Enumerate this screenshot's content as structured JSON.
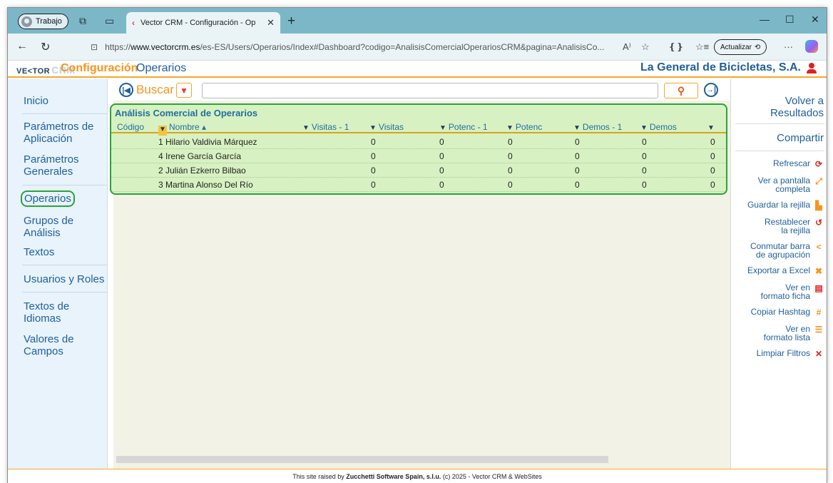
{
  "browser": {
    "profile": "Trabajo",
    "tab_title": "Vector CRM - Configuración - Op",
    "url_prefix": "https://",
    "url_host": "www.vectorcrm.es",
    "url_path": "/es-ES/Users/Operarios/Index#Dashboard?codigo=AnalisisComercialOperariosCRM&pagina=AnalisisCo...",
    "update_label": "Actualizar"
  },
  "header": {
    "logo_text": "VE<TOR",
    "logo_bg": "CRM",
    "title": "Configuración",
    "subtitle": "Operarios",
    "company": "La General de Bicicletas, S.A."
  },
  "sidebar": {
    "items": [
      {
        "label": "Inicio"
      },
      {
        "label": "Parámetros de Aplicación"
      },
      {
        "label": "Parámetros Generales"
      },
      {
        "label": "Operarios"
      },
      {
        "label": "Grupos de Análisis"
      },
      {
        "label": "Textos"
      },
      {
        "label": "Usuarios y Roles"
      },
      {
        "label": "Textos de Idiomas"
      },
      {
        "label": "Valores de Campos"
      }
    ]
  },
  "search": {
    "label": "Buscar",
    "value": ""
  },
  "grid": {
    "title": "Análisis Comercial de Operarios",
    "columns": [
      "Código",
      "Nombre ▴",
      "Visitas - 1",
      "Visitas",
      "Potenc - 1",
      "Potenc",
      "Demos - 1",
      "Demos"
    ],
    "rows": [
      {
        "name": "1 Hilario Valdivia Márquez",
        "v1": "0",
        "v": "0",
        "p1": "0",
        "p": "0",
        "d1": "0",
        "d": "0",
        "t": "0"
      },
      {
        "name": "4 Irene García García",
        "v1": "0",
        "v": "0",
        "p1": "0",
        "p": "0",
        "d1": "0",
        "d": "0",
        "t": "0"
      },
      {
        "name": "2 Julián Ezkerro Bilbao",
        "v1": "0",
        "v": "0",
        "p1": "0",
        "p": "0",
        "d1": "0",
        "d": "0",
        "t": "0"
      },
      {
        "name": "3 Martina Alonso Del Río",
        "v1": "0",
        "v": "0",
        "p1": "0",
        "p": "0",
        "d1": "0",
        "d": "0",
        "t": "0"
      }
    ]
  },
  "right_panel": {
    "back": "Volver a Resultados",
    "share": "Compartir",
    "actions": [
      {
        "label": "Refrescar",
        "icon": "refresh-icon"
      },
      {
        "label": "Ver a pantalla completa",
        "icon": "fullscreen-icon"
      },
      {
        "label": "Guardar la rejilla",
        "icon": "save-icon"
      },
      {
        "label": "Restablecer la rejilla",
        "icon": "reset-icon"
      },
      {
        "label": "Conmutar barra de agrupación",
        "icon": "share-icon"
      },
      {
        "label": "Exportar a Excel",
        "icon": "excel-icon"
      },
      {
        "label": "Ver en formato ficha",
        "icon": "card-icon"
      },
      {
        "label": "Copiar Hashtag",
        "icon": "hashtag-icon"
      },
      {
        "label": "Ver en formato lista",
        "icon": "list-icon"
      },
      {
        "label": "Limpiar Filtros",
        "icon": "clear-icon"
      }
    ]
  },
  "footer": {
    "prefix": "This site raised by ",
    "company": "Zucchetti Software Spain, s.l.u.",
    "suffix": " (c) 2025 - Vector CRM & WebSites"
  }
}
